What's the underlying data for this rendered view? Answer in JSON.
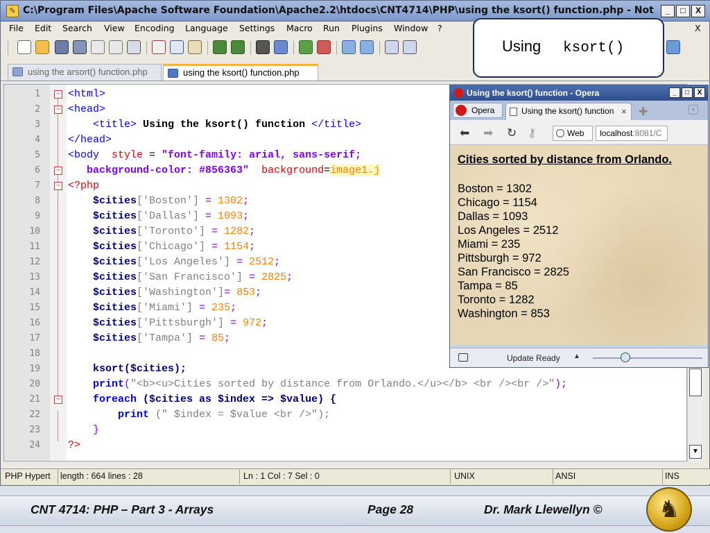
{
  "notepad": {
    "title": "C:\\Program Files\\Apache Software Foundation\\Apache2.2\\htdocs\\CNT4714\\PHP\\using the ksort() function.php - Notepa...",
    "window_buttons": [
      "_",
      "□",
      "X"
    ],
    "menu": [
      "File",
      "Edit",
      "Search",
      "View",
      "Encoding",
      "Language",
      "Settings",
      "Macro",
      "Run",
      "Plugins",
      "Window",
      "?"
    ],
    "menu_close": "X",
    "tabs": [
      {
        "label": "using the arsort() function.php",
        "active": false
      },
      {
        "label": "using the ksort() function.php",
        "active": true
      }
    ],
    "line_numbers": [
      "1",
      "2",
      "3",
      "4",
      "5",
      "6",
      "7",
      "8",
      "9",
      "10",
      "11",
      "12",
      "13",
      "14",
      "15",
      "16",
      "17",
      "18",
      "19",
      "20",
      "21",
      "22",
      "23",
      "24"
    ],
    "status": {
      "type": "PHP Hypert",
      "length": "length : 664    lines : 28",
      "position": "Ln : 1    Col : 7    Sel : 0",
      "eol": "UNIX",
      "encoding": "ANSI",
      "mode": "INS"
    }
  },
  "code": {
    "l1_tag": "<html>",
    "l2_tag": "<head>",
    "l3_open": "<title>",
    "l3_text": " Using the ksort() function ",
    "l3_close": "</title>",
    "l4_tag": "</head>",
    "l5_tag": "<body ",
    "l5_attr": " style",
    "l5_eq": " = ",
    "l5_val": "\"font-family: arial, sans-serif;",
    "l6_val": "background-color: #856363\"",
    "l6_attr": "  background",
    "l6_eq": "=",
    "l6_val2": "image1.j",
    "l7_php": "<?php",
    "cities": [
      {
        "var": "$cities",
        "key": "['Boston']",
        "eq": " = ",
        "num": "1302",
        "end": ";"
      },
      {
        "var": "$cities",
        "key": "['Dallas']",
        "eq": " = ",
        "num": "1093",
        "end": ";"
      },
      {
        "var": "$cities",
        "key": "['Toronto']",
        "eq": " = ",
        "num": "1282",
        "end": ";"
      },
      {
        "var": "$cities",
        "key": "['Chicago']",
        "eq": " = ",
        "num": "1154",
        "end": ";"
      },
      {
        "var": "$cities",
        "key": "['Los Angeles']",
        "eq": " = ",
        "num": "2512",
        "end": ";"
      },
      {
        "var": "$cities",
        "key": "['San Francisco']",
        "eq": " = ",
        "num": "2825",
        "end": ";"
      },
      {
        "var": "$cities",
        "key": "['Washington']",
        "eq": "= ",
        "num": "853",
        "end": ";"
      },
      {
        "var": "$cities",
        "key": "['Miami']",
        "eq": " = ",
        "num": "235",
        "end": ";"
      },
      {
        "var": "$cities",
        "key": "['Pittsburgh']",
        "eq": " = ",
        "num": "972",
        "end": ";"
      },
      {
        "var": "$cities",
        "key": "['Tampa']",
        "eq": " = ",
        "num": "85",
        "end": ";"
      }
    ],
    "l19_fn": "ksort",
    "l19_rest": "($cities);",
    "l20_fn": "print",
    "l20_open": "(",
    "l20_str": "\"<b><u>Cities sorted by distance from Orlando.</u></b> <br /><br />\"",
    "l20_close": ");",
    "l21_kw": "foreach",
    "l21_rest": " ($cities as $index => $value) {",
    "l22_kw": "print",
    "l22_rest": " (\" $index = $value <br />\");",
    "l23": "}",
    "l24": "?>"
  },
  "callout": {
    "prefix": "Using",
    "code": "ksort()"
  },
  "opera": {
    "title": "Using the ksort() function - Opera",
    "menu_label": "Opera",
    "tab_label": "Using the ksort() function",
    "tab_close": "×",
    "web_label": "Web",
    "url_host": "localhost",
    "url_path": ":8081/C",
    "heading": "Cities sorted by distance from Orlando.",
    "results": [
      "Boston = 1302",
      "Chicago = 1154",
      "Dallas = 1093",
      "Los Angeles = 2512",
      "Miami = 235",
      "Pittsburgh = 972",
      "San Francisco = 2825",
      "Tampa = 85",
      "Toronto = 1282",
      "Washington = 853"
    ],
    "status_text": "Update Ready"
  },
  "footer": {
    "course": "CNT 4714:  PHP – Part 3 - Arrays",
    "page": "Page 28",
    "author": "Dr. Mark Llewellyn ©"
  }
}
